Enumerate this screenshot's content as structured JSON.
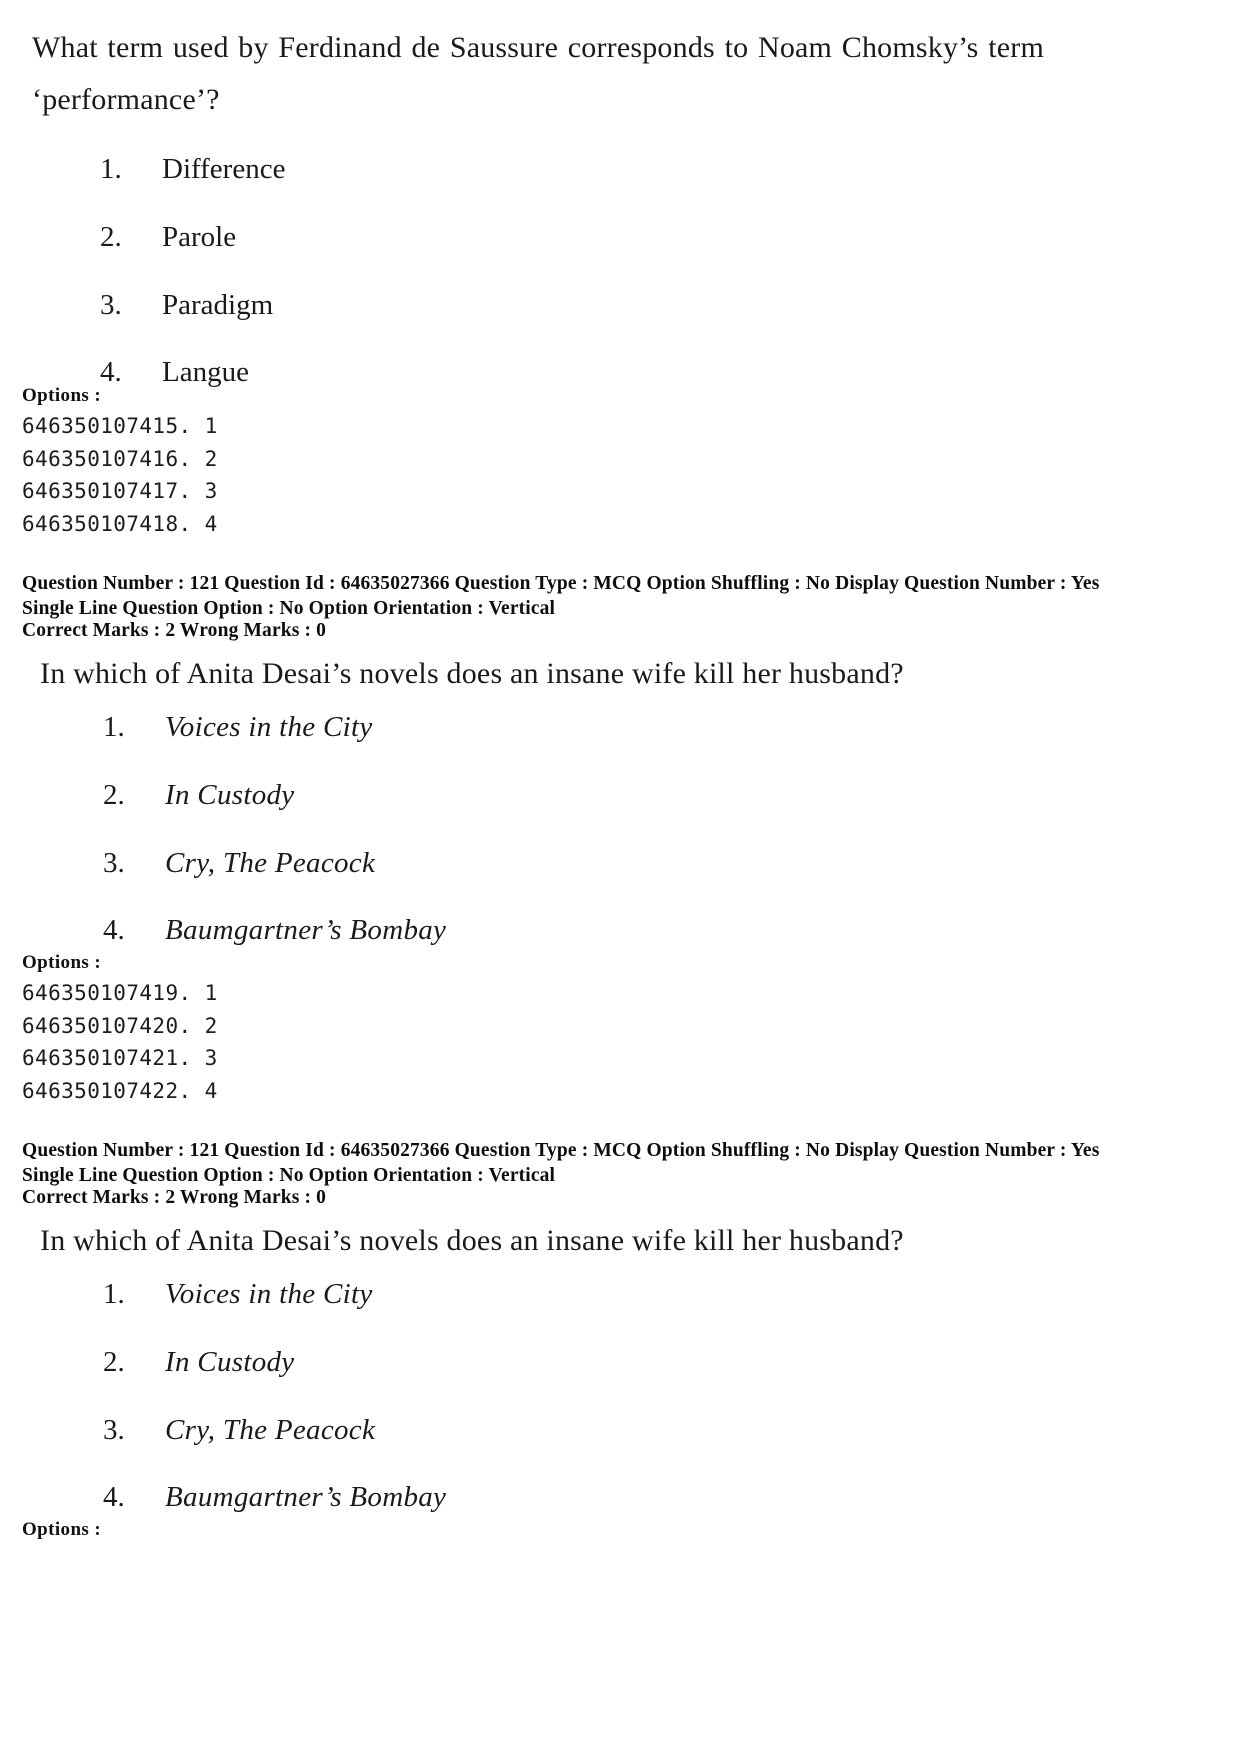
{
  "document": {
    "type": "exam-question-paper-scan"
  },
  "blocks": [
    {
      "id": "block-1",
      "stem": "What term used by Ferdinand de Saussure corresponds to Noam Chomsky’s term ‘performance’?",
      "choices": [
        {
          "num": "1.",
          "text": "Difference",
          "italic": false
        },
        {
          "num": "2.",
          "text": "Parole",
          "italic": false
        },
        {
          "num": "3.",
          "text": "Paradigm",
          "italic": false
        },
        {
          "num": "4.",
          "text": "Langue",
          "italic": false
        }
      ],
      "options_label": "Options :",
      "option_ids": [
        "646350107415. 1",
        "646350107416. 2",
        "646350107417. 3",
        "646350107418. 4"
      ]
    },
    {
      "id": "block-2",
      "stem": "In which of Anita Desai’s novels does an insane wife kill her husband?",
      "choices": [
        {
          "num": "1.",
          "text": "Voices in the City",
          "italic": true
        },
        {
          "num": "2.",
          "text": "In Custody",
          "italic": true
        },
        {
          "num": "3.",
          "text": "Cry, The Peacock",
          "italic": true
        },
        {
          "num": "4.",
          "text": "Baumgartner’s Bombay",
          "italic": true
        }
      ],
      "options_label": "Options :",
      "option_ids": [
        "646350107419. 1",
        "646350107420. 2",
        "646350107421. 3",
        "646350107422. 4"
      ]
    },
    {
      "id": "block-3",
      "stem": "In which of Anita Desai’s novels does an insane wife kill her husband?",
      "choices": [
        {
          "num": "1.",
          "text": "Voices in the City",
          "italic": true
        },
        {
          "num": "2.",
          "text": "In Custody",
          "italic": true
        },
        {
          "num": "3.",
          "text": "Cry, The Peacock",
          "italic": true
        },
        {
          "num": "4.",
          "text": "Baumgartner’s Bombay",
          "italic": true
        }
      ],
      "options_label": "Options :",
      "option_ids": []
    }
  ],
  "metadata": [
    {
      "id": "meta-1",
      "line1": "Question Number : 121  Question Id : 64635027366  Question Type : MCQ  Option Shuffling : No  Display Question Number : Yes",
      "line2": "Single Line Question Option : No  Option Orientation : Vertical",
      "line3": "Correct Marks : 2  Wrong Marks : 0"
    },
    {
      "id": "meta-2",
      "line1": "Question Number : 121  Question Id : 64635027366  Question Type : MCQ  Option Shuffling : No  Display Question Number : Yes",
      "line2": "Single Line Question Option : No  Option Orientation : Vertical",
      "line3": "Correct Marks : 2  Wrong Marks : 0"
    }
  ]
}
